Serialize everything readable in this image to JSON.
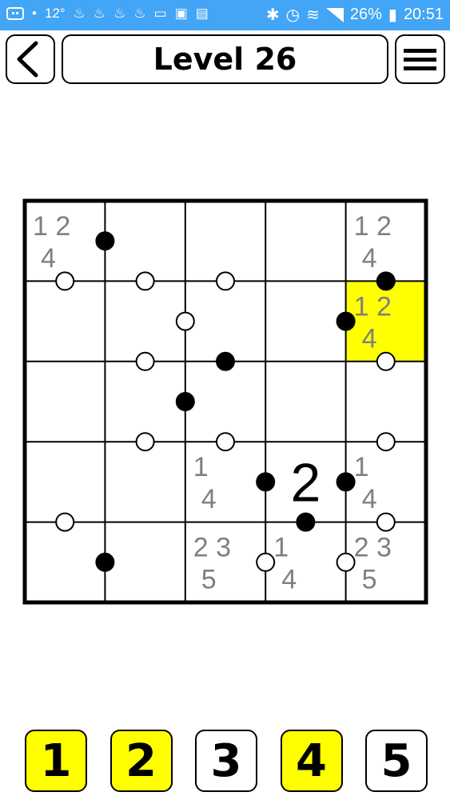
{
  "status_bar": {
    "temperature": "12°",
    "battery": "26%",
    "time": "20:51"
  },
  "header": {
    "title": "Level 26",
    "back_icon": "chevron-left-icon",
    "menu_icon": "hamburger-menu-icon"
  },
  "colors": {
    "status_bar": "#42a5f5",
    "highlight": "#ffff00",
    "candidate": "#808080",
    "value": "#000000"
  },
  "puzzle": {
    "size": 5,
    "selected_cell": [
      1,
      4
    ],
    "values": [
      {
        "row": 3,
        "col": 3,
        "value": "2"
      }
    ],
    "candidates": [
      {
        "row": 0,
        "col": 0,
        "line1": "1 2",
        "line2": "4"
      },
      {
        "row": 0,
        "col": 4,
        "line1": "1 2",
        "line2": "4"
      },
      {
        "row": 1,
        "col": 4,
        "line1": "1 2",
        "line2": "4"
      },
      {
        "row": 3,
        "col": 2,
        "line1": "1",
        "line2": "4"
      },
      {
        "row": 3,
        "col": 4,
        "line1": "1",
        "line2": "4"
      },
      {
        "row": 4,
        "col": 2,
        "line1": "2 3",
        "line2": "5"
      },
      {
        "row": 4,
        "col": 3,
        "line1": "1",
        "line2": "4"
      },
      {
        "row": 4,
        "col": 4,
        "line1": "2 3",
        "line2": "5"
      }
    ],
    "dots": [
      {
        "between": [
          [
            0,
            0
          ],
          [
            0,
            1
          ]
        ],
        "type": "black"
      },
      {
        "between": [
          [
            0,
            0
          ],
          [
            1,
            0
          ]
        ],
        "type": "white"
      },
      {
        "between": [
          [
            0,
            1
          ],
          [
            1,
            1
          ]
        ],
        "type": "white"
      },
      {
        "between": [
          [
            0,
            2
          ],
          [
            1,
            2
          ]
        ],
        "type": "white"
      },
      {
        "between": [
          [
            0,
            4
          ],
          [
            1,
            4
          ]
        ],
        "type": "black"
      },
      {
        "between": [
          [
            1,
            1
          ],
          [
            1,
            2
          ]
        ],
        "type": "white"
      },
      {
        "between": [
          [
            1,
            3
          ],
          [
            1,
            4
          ]
        ],
        "type": "black"
      },
      {
        "between": [
          [
            1,
            1
          ],
          [
            2,
            1
          ]
        ],
        "type": "white"
      },
      {
        "between": [
          [
            1,
            2
          ],
          [
            2,
            2
          ]
        ],
        "type": "black"
      },
      {
        "between": [
          [
            1,
            4
          ],
          [
            2,
            4
          ]
        ],
        "type": "white"
      },
      {
        "between": [
          [
            2,
            1
          ],
          [
            2,
            2
          ]
        ],
        "type": "black"
      },
      {
        "between": [
          [
            2,
            1
          ],
          [
            3,
            1
          ]
        ],
        "type": "white"
      },
      {
        "between": [
          [
            2,
            2
          ],
          [
            3,
            2
          ]
        ],
        "type": "white"
      },
      {
        "between": [
          [
            2,
            4
          ],
          [
            3,
            4
          ]
        ],
        "type": "white"
      },
      {
        "between": [
          [
            3,
            2
          ],
          [
            3,
            3
          ]
        ],
        "type": "black"
      },
      {
        "between": [
          [
            3,
            3
          ],
          [
            3,
            4
          ]
        ],
        "type": "black"
      },
      {
        "between": [
          [
            3,
            0
          ],
          [
            4,
            0
          ]
        ],
        "type": "white"
      },
      {
        "between": [
          [
            3,
            3
          ],
          [
            4,
            3
          ]
        ],
        "type": "black"
      },
      {
        "between": [
          [
            3,
            4
          ],
          [
            4,
            4
          ]
        ],
        "type": "white"
      },
      {
        "between": [
          [
            4,
            0
          ],
          [
            4,
            1
          ]
        ],
        "type": "black"
      },
      {
        "between": [
          [
            4,
            2
          ],
          [
            4,
            3
          ]
        ],
        "type": "white"
      },
      {
        "between": [
          [
            4,
            3
          ],
          [
            4,
            4
          ]
        ],
        "type": "white"
      }
    ]
  },
  "digit_buttons": [
    {
      "label": "1",
      "highlighted": true
    },
    {
      "label": "2",
      "highlighted": true
    },
    {
      "label": "3",
      "highlighted": false
    },
    {
      "label": "4",
      "highlighted": true
    },
    {
      "label": "5",
      "highlighted": false
    }
  ]
}
